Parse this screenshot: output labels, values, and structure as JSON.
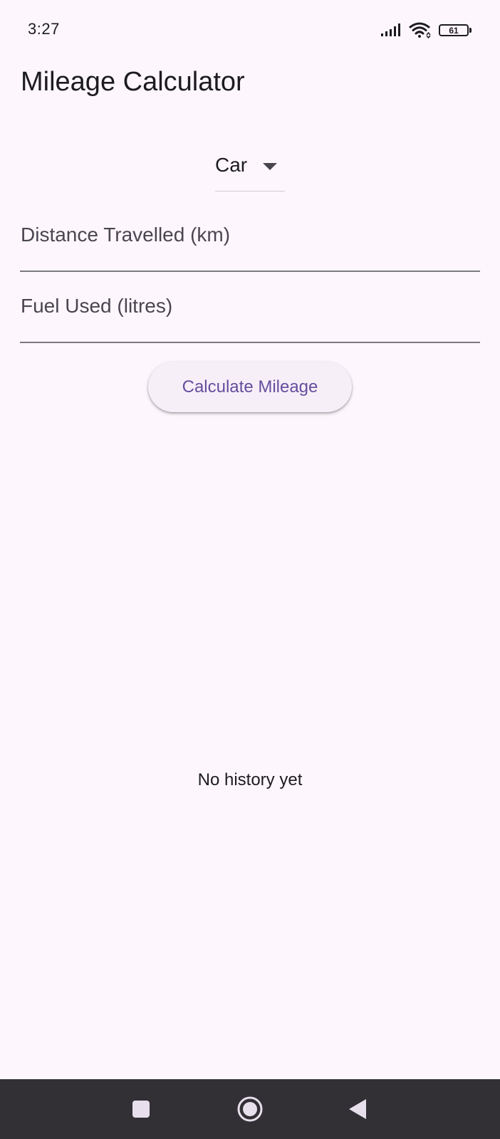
{
  "status_bar": {
    "time": "3:27",
    "battery_level": "61",
    "icons": [
      "signal-icon",
      "wifi-icon",
      "battery-icon"
    ]
  },
  "app_bar": {
    "title": "Mileage Calculator"
  },
  "form": {
    "vehicle_type": {
      "selected": "Car",
      "icon": "dropdown-arrow-icon"
    },
    "distance_field": {
      "placeholder": "Distance Travelled (km)",
      "value": ""
    },
    "fuel_field": {
      "placeholder": "Fuel Used (litres)",
      "value": ""
    },
    "calculate_button": {
      "label": "Calculate Mileage"
    }
  },
  "history": {
    "empty_message": "No history yet"
  },
  "navigation_bar": {
    "buttons": [
      "recent-apps-icon",
      "home-icon",
      "back-icon"
    ]
  },
  "colors": {
    "background": "#fdf7fd",
    "accent": "#634e9d",
    "button_surface": "#f6eff8",
    "nav_bar": "#322f35"
  }
}
